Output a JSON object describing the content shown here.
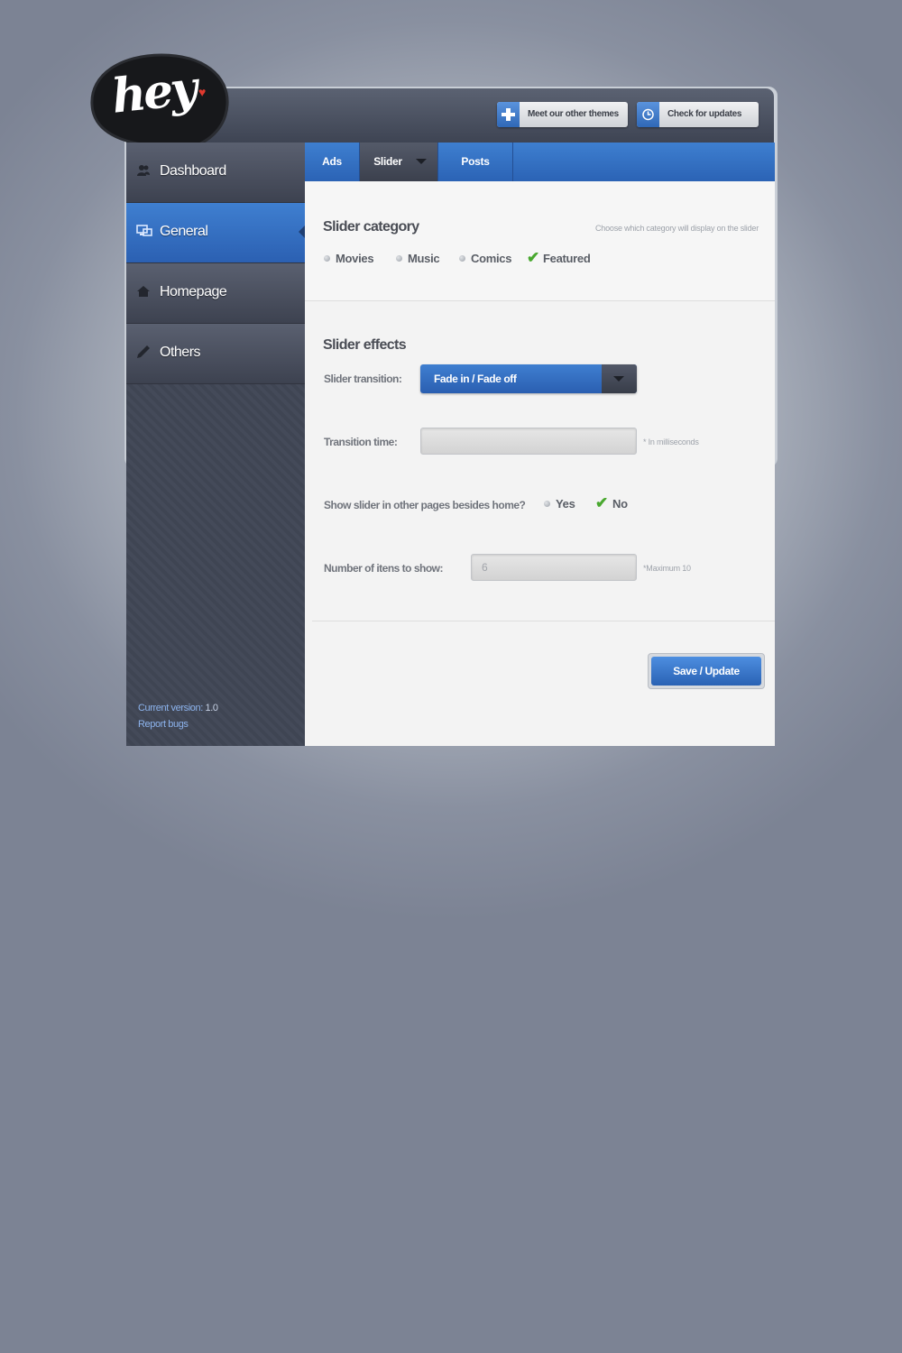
{
  "brand": {
    "logo_text": "hey"
  },
  "header": {
    "buttons": [
      {
        "label": "Meet our other themes",
        "icon": "plus-icon"
      },
      {
        "label": "Check for updates",
        "icon": "clock-icon"
      }
    ]
  },
  "sidebar": {
    "items": [
      {
        "label": "Dashboard",
        "icon": "users-icon"
      },
      {
        "label": "General",
        "icon": "monitor-icon",
        "active": true
      },
      {
        "label": "Homepage",
        "icon": "home-icon"
      },
      {
        "label": "Others",
        "icon": "pencil-icon"
      }
    ],
    "footer": {
      "version_label": "Current version:",
      "version_value": "1.0",
      "report_link": "Report bugs"
    }
  },
  "tabs": [
    {
      "label": "Ads"
    },
    {
      "label": "Slider",
      "selected": true
    },
    {
      "label": "Posts"
    }
  ],
  "slider_category": {
    "title": "Slider category",
    "hint": "Choose which category will display on the slider",
    "options": [
      "Movies",
      "Music",
      "Comics",
      "Featured"
    ],
    "selected": "Featured"
  },
  "slider_effects": {
    "title": "Slider effects",
    "transition_label": "Slider transition:",
    "transition_value": "Fade in / Fade off",
    "time_label": "Transition time:",
    "time_value": "",
    "time_hint": "* In milliseconds",
    "show_label": "Show slider in other pages besides home?",
    "show_options": [
      "Yes",
      "No"
    ],
    "show_selected": "No",
    "items_label": "Number of itens to show:",
    "items_value": "6",
    "items_hint": "*Maximum 10"
  },
  "save_label": "Save / Update",
  "colors": {
    "accent": "#2f6cc0",
    "check": "#49a82f",
    "sidebar_bg": "#40465a"
  }
}
